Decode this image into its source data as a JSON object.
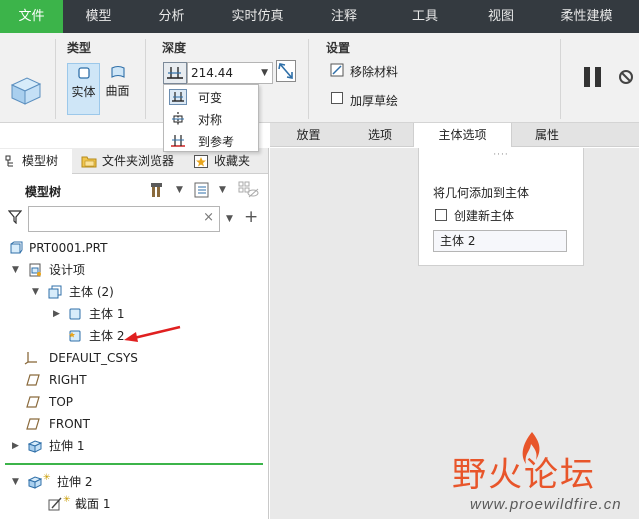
{
  "menubar": {
    "tabs": [
      "文件",
      "模型",
      "分析",
      "实时仿真",
      "注释",
      "工具",
      "视图",
      "柔性建模"
    ]
  },
  "ribbon": {
    "type_group": {
      "label": "类型",
      "solid": "实体",
      "surface": "曲面"
    },
    "depth_group": {
      "label": "深度",
      "value": "214.44"
    },
    "settings_group": {
      "label": "设置",
      "remove_material": "移除材料",
      "thicken_sketch": "加厚草绘"
    }
  },
  "depth_dropdown": {
    "options": [
      "可变",
      "对称",
      "到参考"
    ]
  },
  "subtabs": [
    "放置",
    "选项",
    "主体选项",
    "属性"
  ],
  "left_tabs": [
    "模型树",
    "文件夹浏览器",
    "收藏夹"
  ],
  "tree": {
    "header": "模型树",
    "filter_placeholder": "",
    "items": [
      "PRT0001.PRT",
      "设计项",
      "主体 (2)",
      "主体 1",
      "主体 2",
      "DEFAULT_CSYS",
      "RIGHT",
      "TOP",
      "FRONT",
      "拉伸 1",
      "拉伸 2",
      "截面 1"
    ]
  },
  "body_panel": {
    "label": "将几何添加到主体",
    "create_new_body": "创建新主体",
    "body_value": "主体 2"
  },
  "watermark": {
    "title": "野火论坛",
    "url": "www.proewildfire.cn"
  },
  "colors": {
    "accent_green": "#3cb44a",
    "menubar_bg": "#343a40",
    "arrow_red": "#e02020"
  }
}
